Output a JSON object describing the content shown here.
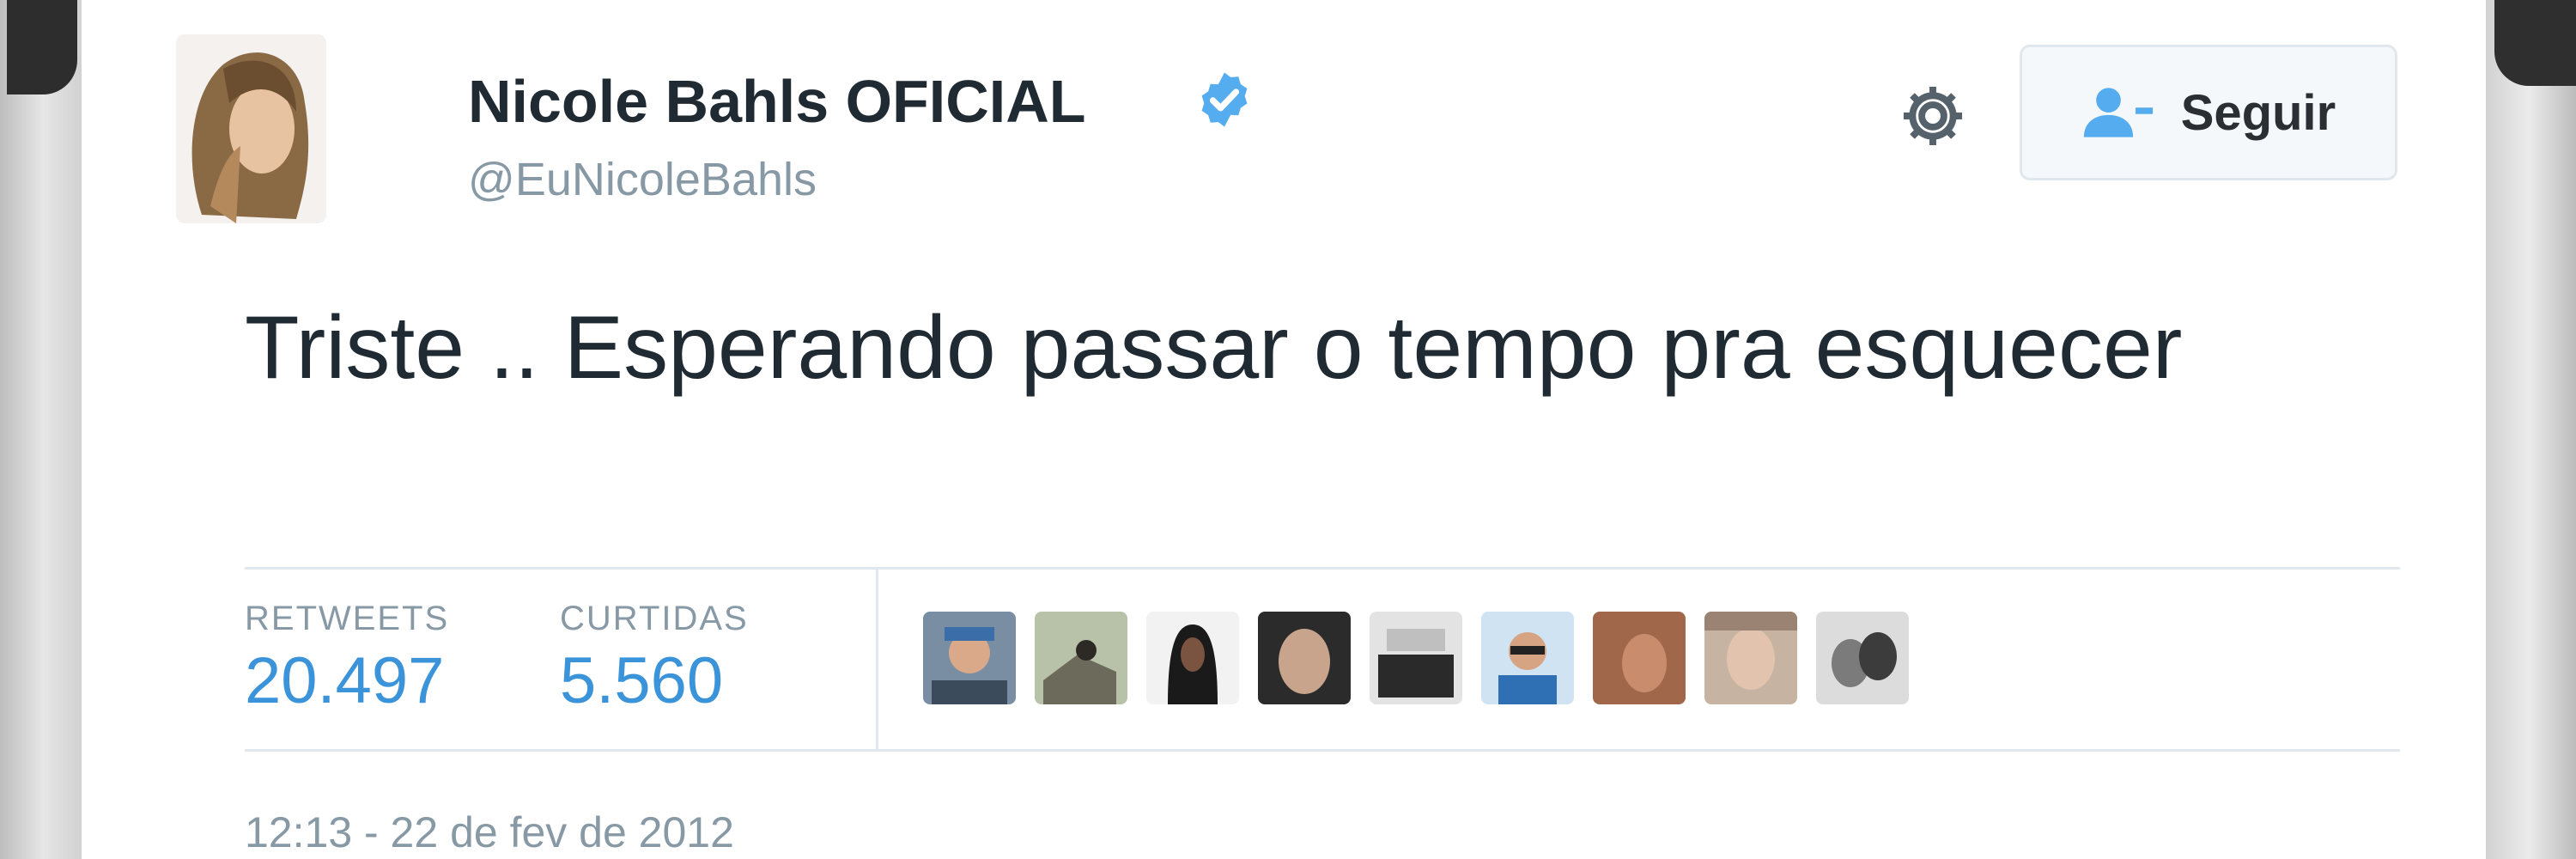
{
  "tweet": {
    "author": {
      "name": "Nicole Bahls OFICIAL",
      "handle": "@EuNicoleBahls",
      "verified": true
    },
    "follow_button": {
      "label": "Seguir",
      "icon": "person-add-icon"
    },
    "settings_icon": "gear-icon",
    "text": "Triste .. Esperando passar o tempo pra esquecer",
    "stats": {
      "retweets": {
        "label": "RETWEETS",
        "value": "20.497"
      },
      "likes": {
        "label": "CURTIDAS",
        "value": "5.560"
      }
    },
    "liker_avatars": [
      "avatar-1",
      "avatar-2",
      "avatar-3",
      "avatar-4",
      "avatar-5",
      "avatar-6",
      "avatar-7",
      "avatar-8",
      "avatar-9"
    ],
    "timestamp": "12:13 - 22 de fev de 2012"
  },
  "colors": {
    "text": "#1f2a33",
    "muted": "#8899a6",
    "accent": "#3b94d9",
    "verified": "#55acee",
    "border": "#e1e8ed"
  }
}
